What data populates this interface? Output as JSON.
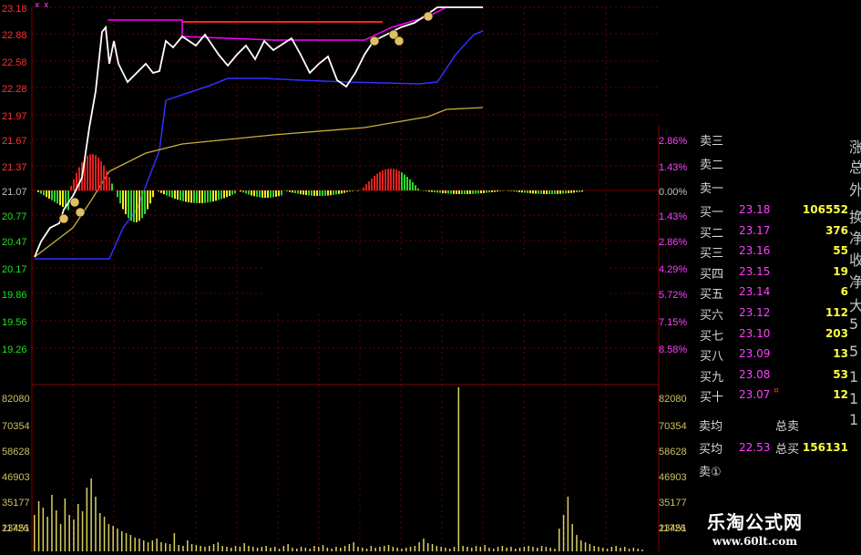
{
  "title_icons": [
    "x",
    "x"
  ],
  "price_axis_left": [
    "23.18",
    "22.88",
    "22.58",
    "22.28",
    "21.97",
    "21.67",
    "21.37",
    "21.07",
    "20.77",
    "20.47",
    "20.17",
    "19.86",
    "19.56",
    "19.26"
  ],
  "pct_axis_right": [
    "2.86%",
    "1.43%",
    "0.00%",
    "1.43%",
    "2.86%",
    "4.29%",
    "5.72%",
    "7.15%",
    "8.58%"
  ],
  "volume_axis": [
    "82080",
    "70354",
    "58628",
    "46903",
    "35177",
    "23451",
    "11726"
  ],
  "order_book": {
    "sell_rows": [
      {
        "label": "卖三"
      },
      {
        "label": "卖二"
      },
      {
        "label": "卖一"
      }
    ],
    "buy_rows": [
      {
        "label": "买一",
        "price": "23.18",
        "vol": "106552"
      },
      {
        "label": "买二",
        "price": "23.17",
        "vol": "376"
      },
      {
        "label": "买三",
        "price": "23.16",
        "vol": "55"
      },
      {
        "label": "买四",
        "price": "23.15",
        "vol": "19"
      },
      {
        "label": "买五",
        "price": "23.14",
        "vol": "6"
      },
      {
        "label": "买六",
        "price": "23.12",
        "vol": "112"
      },
      {
        "label": "买七",
        "price": "23.10",
        "vol": "203"
      },
      {
        "label": "买八",
        "price": "23.09",
        "vol": "13"
      },
      {
        "label": "买九",
        "price": "23.08",
        "vol": "53"
      },
      {
        "label": "买十",
        "price": "23.07",
        "vol": "12",
        "flag": "¤"
      }
    ],
    "side_glyphs": [
      "涨",
      "总",
      "外",
      "换",
      "净",
      "收",
      "净",
      "大",
      "5",
      "5",
      "1",
      "1",
      "1"
    ]
  },
  "stats": {
    "sell_avg_label": "卖均",
    "total_sell_label": "总卖",
    "buy_avg_label": "买均",
    "buy_avg_value": "22.53",
    "total_buy_label": "总买",
    "total_buy_value": "156131",
    "sell_1_label": "卖①"
  },
  "watermark": {
    "title": "乐淘公式网",
    "url": "www.60lt.com"
  },
  "colors": {
    "price_line": "#ffffff",
    "avg_line": "#c8b040",
    "blue_line": "#3030ff",
    "magenta_line": "#ff00ff",
    "red_line": "#ff2020",
    "axis_red": "#ff3030",
    "axis_green": "#20e020",
    "pct_magenta": "#ff40ff",
    "grid": "#6a0000",
    "volume_bar": "#d8d060"
  }
}
